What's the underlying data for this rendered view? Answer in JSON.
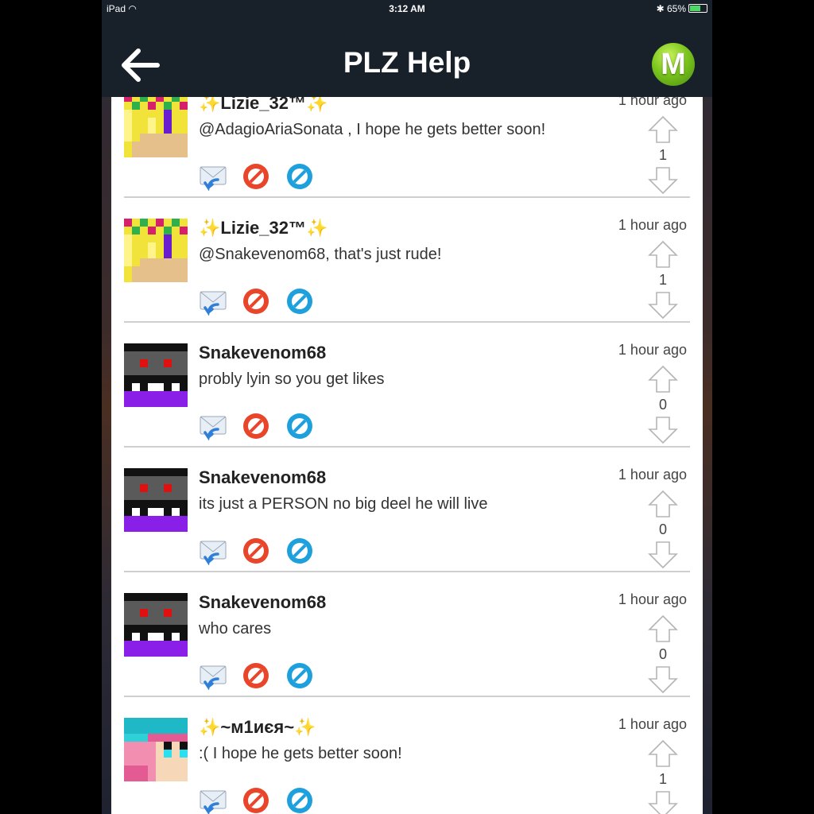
{
  "status": {
    "device": "iPad",
    "time": "3:12 AM",
    "battery": "65%"
  },
  "nav": {
    "title": "PLZ Help",
    "logo_letter": "M"
  },
  "comments": [
    {
      "user": "✨Lizie_32™✨",
      "text": "@AdagioAriaSonata , I hope he gets better soon!",
      "time": "1 hour ago",
      "score": "1"
    },
    {
      "user": "✨Lizie_32™✨",
      "text": "@Snakevenom68, that's just rude!",
      "time": "1 hour ago",
      "score": "1"
    },
    {
      "user": "Snakevenom68",
      "text": "probly lyin so you get likes",
      "time": "1 hour ago",
      "score": "0"
    },
    {
      "user": "Snakevenom68",
      "text": "its just a PERSON no big deel he will live",
      "time": "1 hour ago",
      "score": "0"
    },
    {
      "user": "Snakevenom68",
      "text": "who cares",
      "time": "1 hour ago",
      "score": "0"
    },
    {
      "user": "✨~м1иєя~✨",
      "text": ":( I hope he gets better soon!",
      "time": "1 hour ago",
      "score": "1"
    }
  ],
  "colors": {
    "navbar": "#18202a",
    "accent_green": "#7cc61e",
    "reply_blue": "#2f7fd8",
    "block_red": "#e8452a",
    "flag_blue": "#1ea0dc"
  }
}
